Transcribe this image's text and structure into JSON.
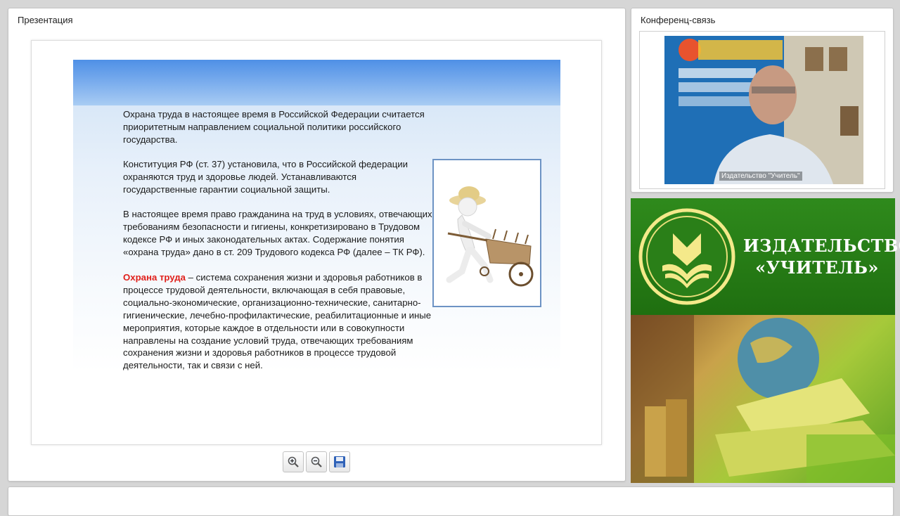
{
  "presentation": {
    "title": "Презентация",
    "slide": {
      "para1": "Охрана труда в настоящее время в Российской Федерации считается приоритетным направлением социальной политики российского государства.",
      "para2": "Конституция РФ (ст. 37) установила, что в Российской федерации охраняются труд и здоровье людей. Устанавливаются государственные гарантии социальной защиты.",
      "para3": "В настоящее время право гражданина на труд в условиях, отвечающих требованиям безопасности и гигиены, конкретизировано в Трудовом кодексе РФ и иных законодательных актах. Содержание понятия «охрана труда» дано в ст. 209 Трудового кодекса РФ (далее – ТК РФ).",
      "para4_term": "Охрана труда",
      "para4_rest": " – система сохранения жизни и здоровья работников в процессе трудовой деятельности, включающая в себя правовые, социально-экономические, организационно-технические, санитарно-гигиенические, лечебно-профилактические, реабилитационные и иные мероприятия, которые каждое в отдельности или в совокупности направлены на создание условий труда, отвечающих требованиям сохранения жизни и здоровья работников в процессе трудовой деятельности, так и связи с ней."
    },
    "toolbar": {
      "zoom_in_icon": "zoom-in-icon",
      "zoom_out_icon": "zoom-out-icon",
      "save_icon": "floppy-disk-icon"
    }
  },
  "conference": {
    "title": "Конференц-связь",
    "video_caption": "Издательство \"Учитель\""
  },
  "banner": {
    "publisher_line1": "ИЗДАТЕЛЬСТВО",
    "publisher_line2": "«УЧИТЕЛЬ»"
  },
  "colors": {
    "accent_red": "#e0201b",
    "slide_header_blue": "#4f90e6",
    "banner_green": "#2f8a1c"
  }
}
